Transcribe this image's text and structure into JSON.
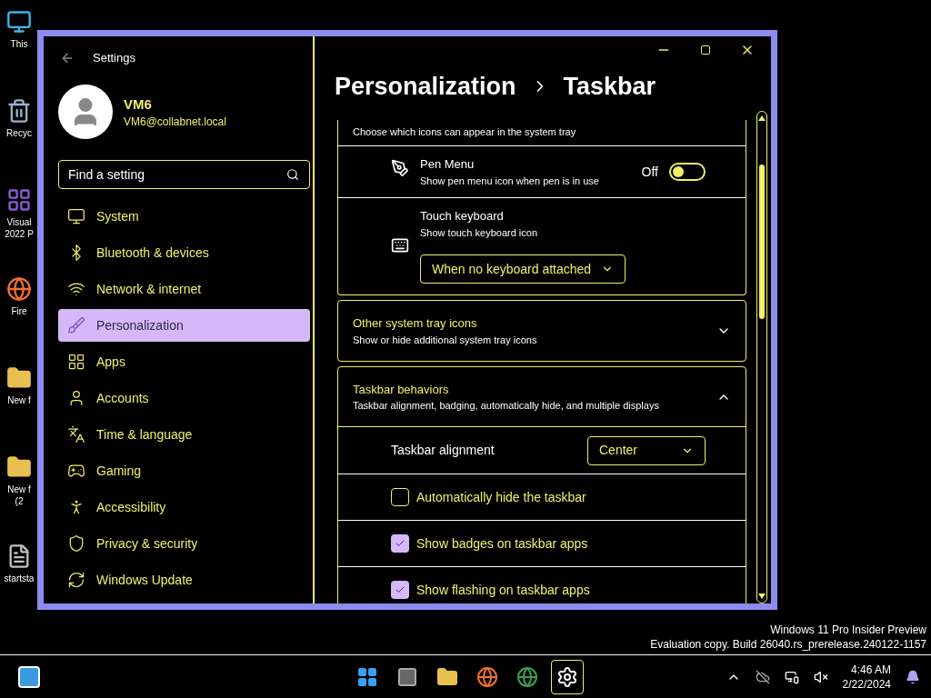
{
  "desktop_icons": [
    {
      "label": "This",
      "kind": "monitor"
    },
    {
      "label": "Recyc",
      "kind": "bin"
    },
    {
      "label": "Visual\n2022 P",
      "kind": "app"
    },
    {
      "label": "Fire",
      "kind": "browser"
    },
    {
      "label": "New f",
      "kind": "folder"
    },
    {
      "label": "New f\n(2",
      "kind": "folder"
    },
    {
      "label": "startsta",
      "kind": "file"
    }
  ],
  "window": {
    "title": "Settings"
  },
  "user": {
    "name": "VM6",
    "email": "VM6@collabnet.local"
  },
  "search": {
    "placeholder": "Find a setting"
  },
  "nav": [
    {
      "label": "System",
      "selected": false
    },
    {
      "label": "Bluetooth & devices",
      "selected": false
    },
    {
      "label": "Network & internet",
      "selected": false
    },
    {
      "label": "Personalization",
      "selected": true
    },
    {
      "label": "Apps",
      "selected": false
    },
    {
      "label": "Accounts",
      "selected": false
    },
    {
      "label": "Time & language",
      "selected": false
    },
    {
      "label": "Gaming",
      "selected": false
    },
    {
      "label": "Accessibility",
      "selected": false
    },
    {
      "label": "Privacy & security",
      "selected": false
    },
    {
      "label": "Windows Update",
      "selected": false
    }
  ],
  "breadcrumb": [
    "Personalization",
    "Taskbar"
  ],
  "tray_card": {
    "description": "Choose which icons can appear in the system tray",
    "rows": [
      {
        "kind": "toggle",
        "title": "Pen Menu",
        "subtitle": "Show pen menu icon when pen is in use",
        "state_label": "Off",
        "on": false
      },
      {
        "kind": "dropdown",
        "title": "Touch keyboard",
        "subtitle": "Show touch keyboard icon",
        "value": "When no keyboard attached"
      }
    ]
  },
  "sections": [
    {
      "title": "Other system tray icons",
      "subtitle": "Show or hide additional system tray icons",
      "expanded": false
    },
    {
      "title": "Taskbar behaviors",
      "subtitle": "Taskbar alignment, badging, automatically hide, and multiple displays",
      "expanded": true,
      "rows": [
        {
          "kind": "dropdown",
          "label": "Taskbar alignment",
          "value": "Center"
        },
        {
          "kind": "checkbox",
          "label": "Automatically hide the taskbar",
          "checked": false
        },
        {
          "kind": "checkbox",
          "label": "Show badges on taskbar apps",
          "checked": true
        },
        {
          "kind": "checkbox",
          "label": "Show flashing on taskbar apps",
          "checked": true
        }
      ]
    }
  ],
  "os_notice": [
    "Windows 11 Pro Insider Preview",
    "Evaluation copy. Build 26040.rs_prerelease.240122-1157"
  ],
  "taskbar": {
    "apps": [
      {
        "kind": "start",
        "selected": false
      },
      {
        "kind": "taskview",
        "selected": false
      },
      {
        "kind": "explorer",
        "selected": false
      },
      {
        "kind": "firefox",
        "selected": false
      },
      {
        "kind": "chrome",
        "selected": false
      },
      {
        "kind": "settings",
        "selected": true
      }
    ],
    "time": "4:46 AM",
    "date": "2/22/2024"
  }
}
